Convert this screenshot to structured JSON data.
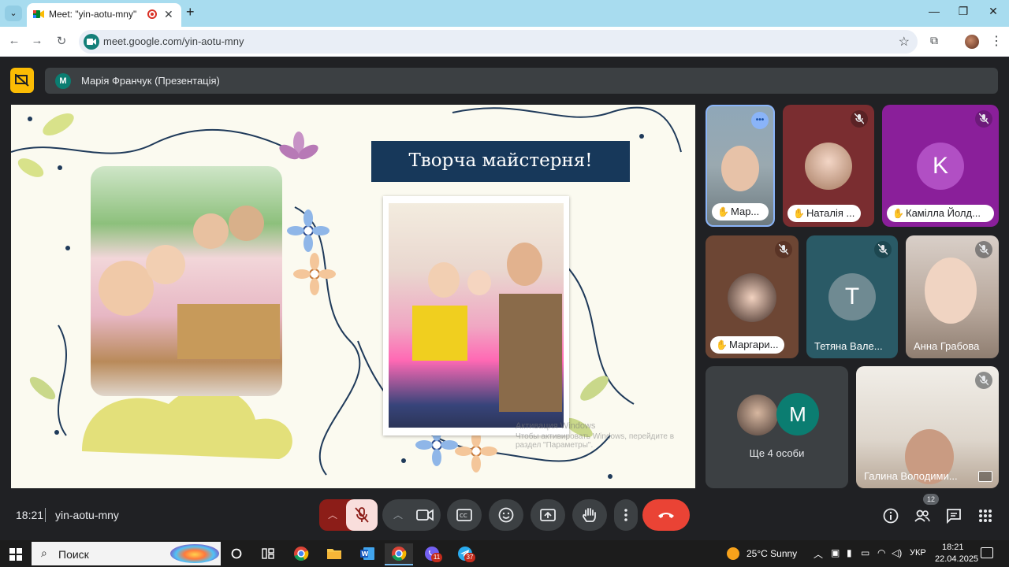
{
  "browser": {
    "tab_title": "Meet: \"yin-aotu-mny\"",
    "url": "meet.google.com/yin-aotu-mny",
    "tab_menu_icon": "chevron-down-icon",
    "new_tab_icon": "plus-icon"
  },
  "meet": {
    "presenter_initial": "M",
    "presenter_name": "Марія Франчук (Презентація)",
    "slide": {
      "title": "Творча майстерня!",
      "watermark_line1": "Активация Windows",
      "watermark_line2": "Чтобы активировать Windows, перейдите в раздел \"Параметры\"."
    },
    "participants": [
      {
        "name": "Мар...",
        "hand_raised": true,
        "speaking": true
      },
      {
        "name": "Наталія ...",
        "hand_raised": true,
        "muted": true
      },
      {
        "name": "Камілла Йолд...",
        "hand_raised": true,
        "muted": true,
        "initial": "K"
      },
      {
        "name": "Маргари...",
        "hand_raised": true,
        "muted": true
      },
      {
        "name": "Тетяна Вале...",
        "muted": true,
        "initial": "T"
      },
      {
        "name": "Анна Грабова",
        "muted": true
      },
      {
        "name": "Ще 4 особи",
        "initial": "M"
      },
      {
        "name": "Галина Володими...",
        "muted": true
      }
    ],
    "meeting_time": "18:21",
    "meeting_code": "yin-aotu-mny",
    "people_count": "12",
    "colors": {
      "accent_yellow": "#fbbc04",
      "end_call": "#ea4335",
      "mic_off_bg": "#f9dedc"
    }
  },
  "taskbar": {
    "search_label": "Поиск",
    "weather": "25°C  Sunny",
    "language": "УКР",
    "time": "18:21",
    "date": "22.04.2025",
    "viber_badge": "11",
    "telegram_badge": "37"
  }
}
